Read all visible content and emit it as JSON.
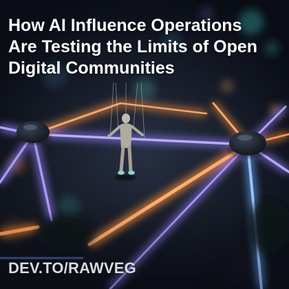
{
  "headline": "How AI Influence Operations Are Testing the Limits of Open Digital Communities",
  "source_label": "DEV.TO/RAWVEG",
  "image_subject": "illustration-network-figure",
  "colors": {
    "text": "#ffffff",
    "source_text": "#d9dbe2",
    "line_orange": "#f08a3a",
    "line_violet": "#8e7cf0",
    "line_blue": "#5f9fe8",
    "node_dark": "#1b222c",
    "bokeh_teal": "#3fb6b3"
  }
}
